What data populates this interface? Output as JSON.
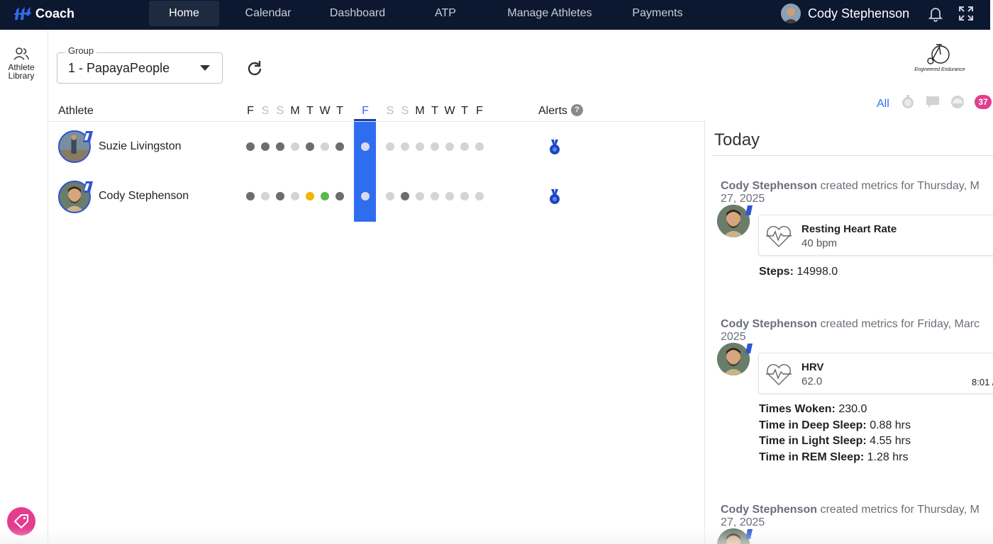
{
  "nav": {
    "brand": "Coach",
    "items": [
      {
        "label": "Home",
        "active": true
      },
      {
        "label": "Calendar"
      },
      {
        "label": "Dashboard"
      },
      {
        "label": "ATP"
      },
      {
        "label": "Manage Athletes"
      },
      {
        "label": "Payments"
      }
    ],
    "user_name": "Cody Stephenson"
  },
  "leftrail": {
    "library_label_1": "Athlete",
    "library_label_2": "Library"
  },
  "group": {
    "label": "Group",
    "value": "1 - PapayaPeople"
  },
  "logo_text": "Engineered Endurance",
  "table": {
    "athlete_header": "Athlete",
    "alerts_header": "Alerts",
    "help": "?",
    "days": [
      "F",
      "S",
      "S",
      "M",
      "T",
      "W",
      "T",
      "F",
      "S",
      "S",
      "M",
      "T",
      "W",
      "T",
      "F"
    ],
    "today_index": 7,
    "rows": [
      {
        "name": "Suzie Livingston",
        "dots": [
          "dark",
          "dark",
          "dark",
          "light",
          "dark",
          "light",
          "dark",
          "today",
          "light",
          "light",
          "light",
          "light",
          "light",
          "light",
          "light"
        ]
      },
      {
        "name": "Cody Stephenson",
        "dots": [
          "dark",
          "light",
          "dark",
          "light",
          "yellow",
          "green",
          "dark",
          "today",
          "light",
          "dark",
          "light",
          "light",
          "light",
          "light",
          "light"
        ]
      }
    ]
  },
  "filters": {
    "all": "All",
    "count": "37"
  },
  "feed": {
    "title": "Today",
    "entries": [
      {
        "author": "Cody Stephenson",
        "text": " created metrics for Thursday, M",
        "text2": "27, 2025",
        "metric_name": "Resting Heart Rate",
        "metric_value": "40 bpm",
        "time": "",
        "extras": [
          {
            "label": "Steps:",
            "value": " 14998.0"
          }
        ]
      },
      {
        "author": "Cody Stephenson",
        "text": " created metrics for Friday, Marc",
        "text2": "2025",
        "metric_name": "HRV",
        "metric_value": "62.0",
        "time": "8:01 /",
        "extras": [
          {
            "label": "Times Woken:",
            "value": " 230.0"
          },
          {
            "label": "Time in Deep Sleep:",
            "value": " 0.88 hrs"
          },
          {
            "label": "Time in Light Sleep:",
            "value": " 4.55 hrs"
          },
          {
            "label": "Time in REM Sleep:",
            "value": " 1.28 hrs"
          }
        ]
      },
      {
        "author": "Cody Stephenson",
        "text": " created metrics for Thursday, M",
        "text2": "27, 2025"
      }
    ]
  },
  "colors": {
    "nav_bg": "#0c1830",
    "accent": "#2f6df0",
    "pink": "#e23d8e",
    "dot_dark": "#6b6d73",
    "dot_light": "#d2d4d8",
    "dot_yellow": "#f2b600",
    "dot_green": "#5bb84a"
  }
}
